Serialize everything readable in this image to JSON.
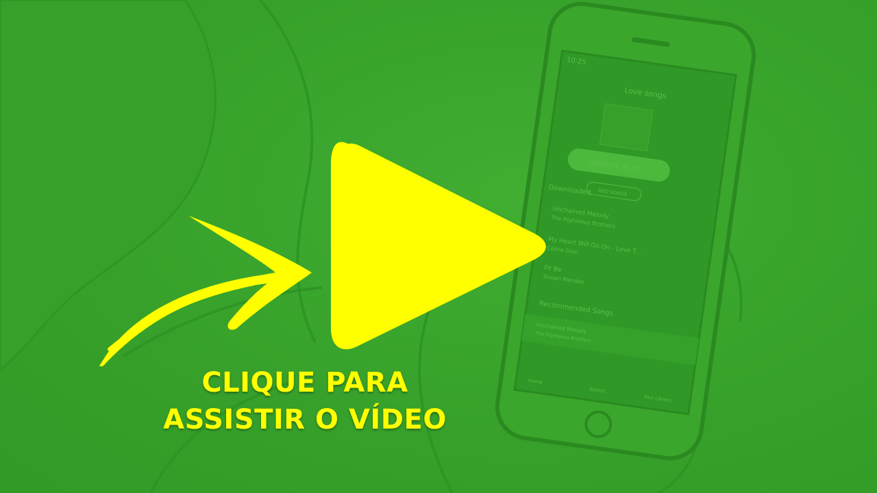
{
  "cta": {
    "line1": "CLIQUE PARA",
    "line2": "ASSISTIR O VÍDEO"
  },
  "phone": {
    "status_time": "10:25",
    "playlist_title": "Love songs",
    "shuffle_label": "SHUFFLE PLAY",
    "add_songs_label": "ADD SONGS",
    "section_downloaded": "Downloaded",
    "section_recommended": "Recommended Songs",
    "tracks": [
      {
        "title": "Unchained Melody",
        "artist": "The Righteous Brothers"
      },
      {
        "title": "My Heart Will Go On - Love T...",
        "artist": "Céline Dion"
      },
      {
        "title": "Fit Be",
        "artist": "Shawn Mendes"
      }
    ],
    "bottom_track": {
      "title": "Unchained Melody",
      "artist": "The Righteous Brothers"
    },
    "nav": [
      "Home",
      "Search",
      "Your Library"
    ]
  },
  "colors": {
    "background": "#3aa62c",
    "accent": "#ffff00",
    "line_art": "#2c8e22"
  },
  "icons": {
    "play": "play-icon",
    "arrow": "curved-arrow-icon"
  }
}
